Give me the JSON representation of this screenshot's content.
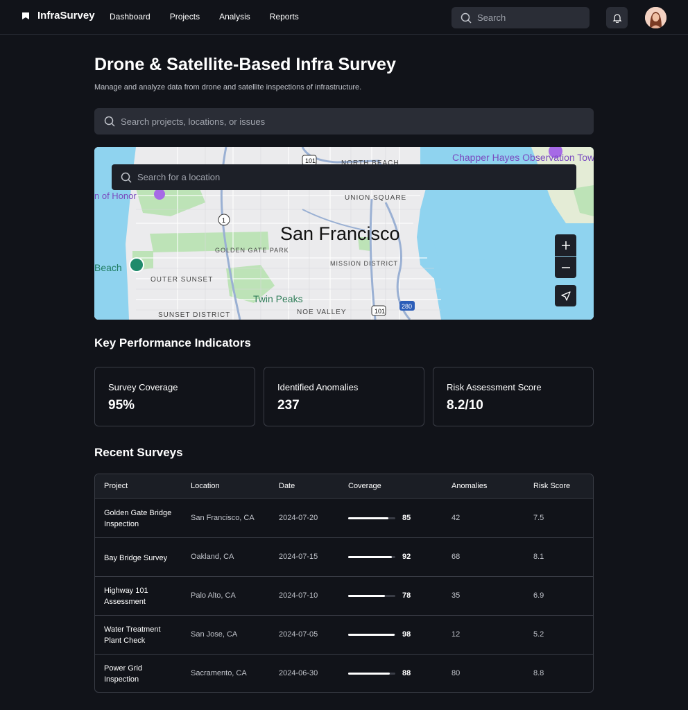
{
  "app": {
    "brand": "InfraSurvey"
  },
  "nav": {
    "items": [
      "Dashboard",
      "Projects",
      "Analysis",
      "Reports"
    ]
  },
  "top_search": {
    "placeholder": "Search"
  },
  "page": {
    "title": "Drone & Satellite-Based Infra Survey",
    "subtitle": "Manage and analyze data from drone and satellite inspections of infrastructure.",
    "search_placeholder": "Search projects, locations, or issues"
  },
  "map": {
    "search_placeholder": "Search for a location",
    "labels": {
      "city": "San Francisco",
      "north_beach": "NORTH BEACH",
      "union_square": "UNION SQUARE",
      "golden_gate_park": "GOLDEN GATE PARK",
      "mission_district": "MISSION DISTRICT",
      "outer_sunset": "OUTER SUNSET",
      "twin_peaks": "Twin Peaks",
      "noe_valley": "NOE VALLEY",
      "sunset_district": "SUNSET DISTRICT",
      "observation_tower": "Chapper Hayes Observation Tower",
      "legion_of_honor": "n of Honor",
      "beach": "Beach",
      "route_101": "101",
      "route_1": "1",
      "route_280": "280"
    }
  },
  "kpi": {
    "title": "Key Performance Indicators",
    "items": [
      {
        "label": "Survey Coverage",
        "value": "95%"
      },
      {
        "label": "Identified Anomalies",
        "value": "237"
      },
      {
        "label": "Risk Assessment Score",
        "value": "8.2/10"
      }
    ]
  },
  "surveys": {
    "title": "Recent Surveys",
    "columns": [
      "Project",
      "Location",
      "Date",
      "Coverage",
      "Anomalies",
      "Risk Score"
    ],
    "rows": [
      {
        "project": "Golden Gate Bridge Inspection",
        "location": "San Francisco, CA",
        "date": "2024-07-20",
        "coverage": 85,
        "anomalies": "42",
        "risk": "7.5"
      },
      {
        "project": "Bay Bridge Survey",
        "location": "Oakland, CA",
        "date": "2024-07-15",
        "coverage": 92,
        "anomalies": "68",
        "risk": "8.1"
      },
      {
        "project": "Highway 101 Assessment",
        "location": "Palo Alto, CA",
        "date": "2024-07-10",
        "coverage": 78,
        "anomalies": "35",
        "risk": "6.9"
      },
      {
        "project": "Water Treatment Plant Check",
        "location": "San Jose, CA",
        "date": "2024-07-05",
        "coverage": 98,
        "anomalies": "12",
        "risk": "5.2"
      },
      {
        "project": "Power Grid Inspection",
        "location": "Sacramento, CA",
        "date": "2024-06-30",
        "coverage": 88,
        "anomalies": "80",
        "risk": "8.8"
      }
    ]
  },
  "colors": {
    "background": "#111319",
    "surface": "#2a2d36",
    "border": "#3a3d46",
    "water": "#8fd3ef",
    "park": "#bde3b7"
  },
  "icons": [
    "logo-icon",
    "search-icon",
    "bell-icon",
    "avatar",
    "plus-icon",
    "minus-icon",
    "navigation-arrow-icon"
  ]
}
